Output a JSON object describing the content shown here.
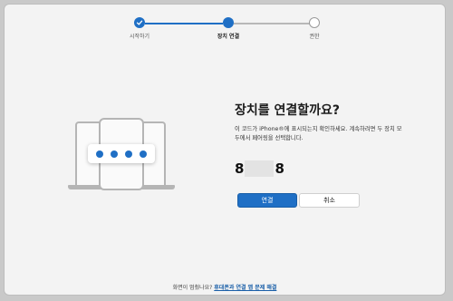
{
  "stepper": {
    "steps": [
      {
        "label": "시작하기",
        "state": "done"
      },
      {
        "label": "장치 연결",
        "state": "current"
      },
      {
        "label": "권한",
        "state": "pending"
      }
    ]
  },
  "main": {
    "title": "장치를 연결할까요?",
    "description": "이 코드가 iPhone®에 표시되는지 확인하세요. 계속하려면 두 장치 모두에서 페어링을 선택합니다.",
    "code_first": "8",
    "code_last": "8"
  },
  "buttons": {
    "connect_label": "연결",
    "cancel_label": "취소"
  },
  "footer": {
    "question": "화면이 멈췄나요?",
    "link_label": "휴대폰과 연결 앱 문제 해결"
  },
  "colors": {
    "accent": "#1f6fc5",
    "background": "#f3f3f3"
  }
}
